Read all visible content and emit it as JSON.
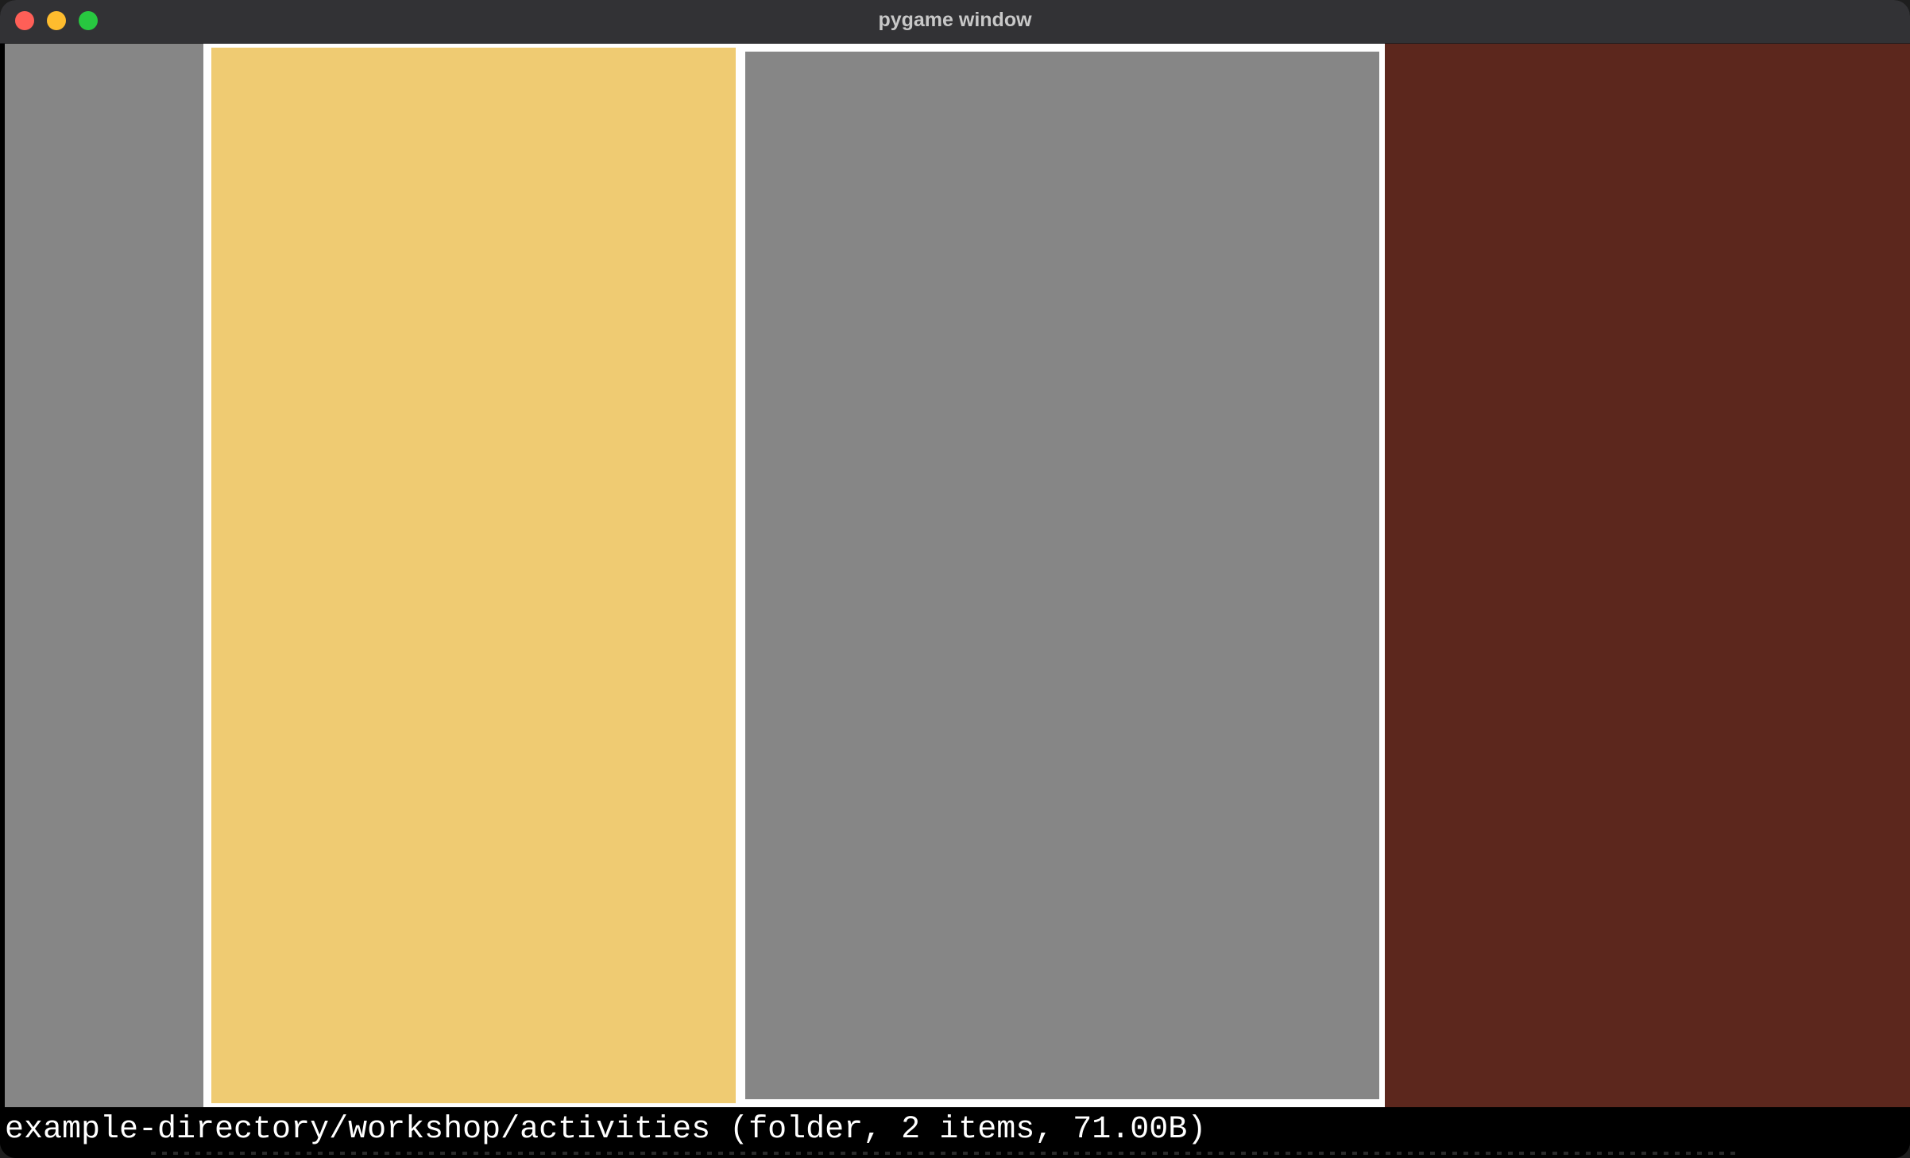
{
  "window": {
    "title": "pygame window"
  },
  "colors": {
    "gray_tile": "#868686",
    "yellow_tile": "#efcb72",
    "brown_tile": "#5c271d",
    "selection_border": "#ffffff"
  },
  "status": {
    "text": "example-directory/workshop/activities (folder, 2 items, 71.00B)"
  }
}
